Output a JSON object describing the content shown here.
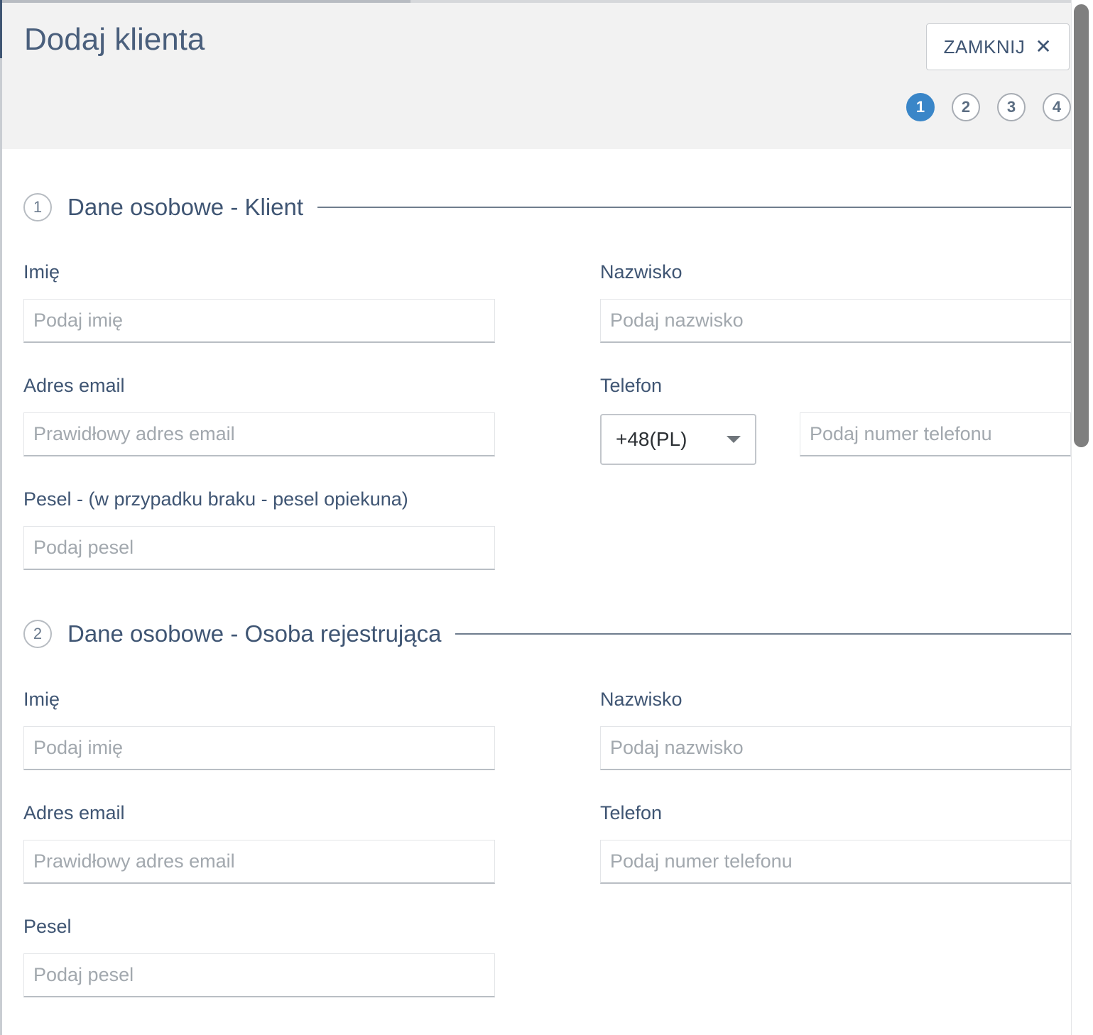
{
  "header": {
    "title": "Dodaj klienta",
    "close_label": "ZAMKNIJ",
    "close_icon": "close-icon",
    "steps": [
      "1",
      "2",
      "3",
      "4"
    ],
    "active_step": "1"
  },
  "sections": [
    {
      "number": "1",
      "title": "Dane osobowe - Klient",
      "first_name": {
        "label": "Imię",
        "placeholder": "Podaj imię",
        "value": ""
      },
      "last_name": {
        "label": "Nazwisko",
        "placeholder": "Podaj nazwisko",
        "value": ""
      },
      "email": {
        "label": "Adres email",
        "placeholder": "Prawidłowy adres email",
        "value": ""
      },
      "phone": {
        "label": "Telefon",
        "country_code": "+48(PL)",
        "placeholder": "Podaj numer telefonu",
        "value": ""
      },
      "pesel": {
        "label": "Pesel - (w przypadku braku - pesel opiekuna)",
        "placeholder": "Podaj pesel",
        "value": ""
      }
    },
    {
      "number": "2",
      "title": "Dane osobowe - Osoba rejestrująca",
      "first_name": {
        "label": "Imię",
        "placeholder": "Podaj imię",
        "value": ""
      },
      "last_name": {
        "label": "Nazwisko",
        "placeholder": "Podaj nazwisko",
        "value": ""
      },
      "email": {
        "label": "Adres email",
        "placeholder": "Prawidłowy adres email",
        "value": ""
      },
      "phone": {
        "label": "Telefon",
        "placeholder": "Podaj numer telefonu",
        "value": ""
      },
      "pesel": {
        "label": "Pesel",
        "placeholder": "Podaj pesel",
        "value": ""
      }
    }
  ],
  "colors": {
    "accent": "#3a86c8",
    "heading": "#3f5573",
    "header_bg": "#f2f2f2",
    "placeholder": "#a2a8ae"
  }
}
